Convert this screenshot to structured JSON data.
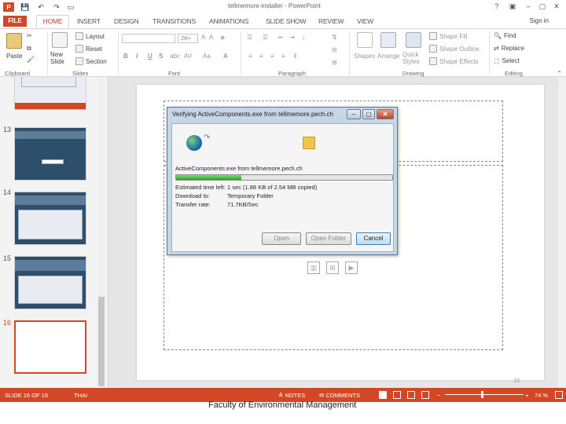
{
  "window": {
    "title": "tellmemore-installer - PowerPoint",
    "minimize": "?",
    "restore": "▢",
    "close": "✕",
    "help": "?",
    "ribbon_display": "▣",
    "logo": "P"
  },
  "tabs": [
    "FILE",
    "HOME",
    "INSERT",
    "DESIGN",
    "TRANSITIONS",
    "ANIMATIONS",
    "SLIDE SHOW",
    "REVIEW",
    "VIEW"
  ],
  "sign_in": "Sign in",
  "ribbon": {
    "clipboard": {
      "label": "Clipboard",
      "paste": "Paste"
    },
    "slides": {
      "label": "Slides",
      "new_slide": "New Slide",
      "layout": "Layout",
      "reset": "Reset",
      "section": "Section"
    },
    "font": {
      "label": "Font",
      "size": "28+",
      "bold": "B",
      "italic": "I",
      "underline": "U",
      "strike": "S",
      "shadow": "abc",
      "spacing": "AV",
      "case": "Aa",
      "color": "A"
    },
    "paragraph": {
      "label": "Paragraph"
    },
    "drawing": {
      "label": "Drawing",
      "shapes": "Shapes",
      "arrange": "Arrange",
      "quick_styles": "Quick Styles",
      "shape_fill": "Shape Fill",
      "shape_outline": "Shape Outline",
      "shape_effects": "Shape Effects"
    },
    "editing": {
      "label": "Editing",
      "find": "Find",
      "replace": "Replace",
      "select": "Select"
    }
  },
  "thumbnails": {
    "numbers": [
      "13",
      "14",
      "15",
      "16"
    ]
  },
  "dialog": {
    "title": "Verifying ActiveComponents.exe from tellmemore.pech.ch",
    "file_line": "ActiveComponents.exe from tellmemore.pech.ch",
    "progress": 0.3,
    "rows": [
      {
        "label": "Estimated time left:",
        "value": "1 sec (1.88 KB of 2.54 MB copied)"
      },
      {
        "label": "Download to:",
        "value": "Temporary Folder"
      },
      {
        "label": "Transfer rate:",
        "value": "71.7KB/Sec"
      }
    ],
    "buttons": {
      "open": "Open",
      "open_folder": "Open Folder",
      "cancel": "Cancel"
    }
  },
  "status": {
    "slide_info": "SLIDE 16 OF 16",
    "language": "THAI",
    "notes": "NOTES",
    "comments": "COMMENTS",
    "zoom": "74 %"
  },
  "footer": {
    "text": "Faculty of Environmental Management",
    "slide_number": "21"
  }
}
